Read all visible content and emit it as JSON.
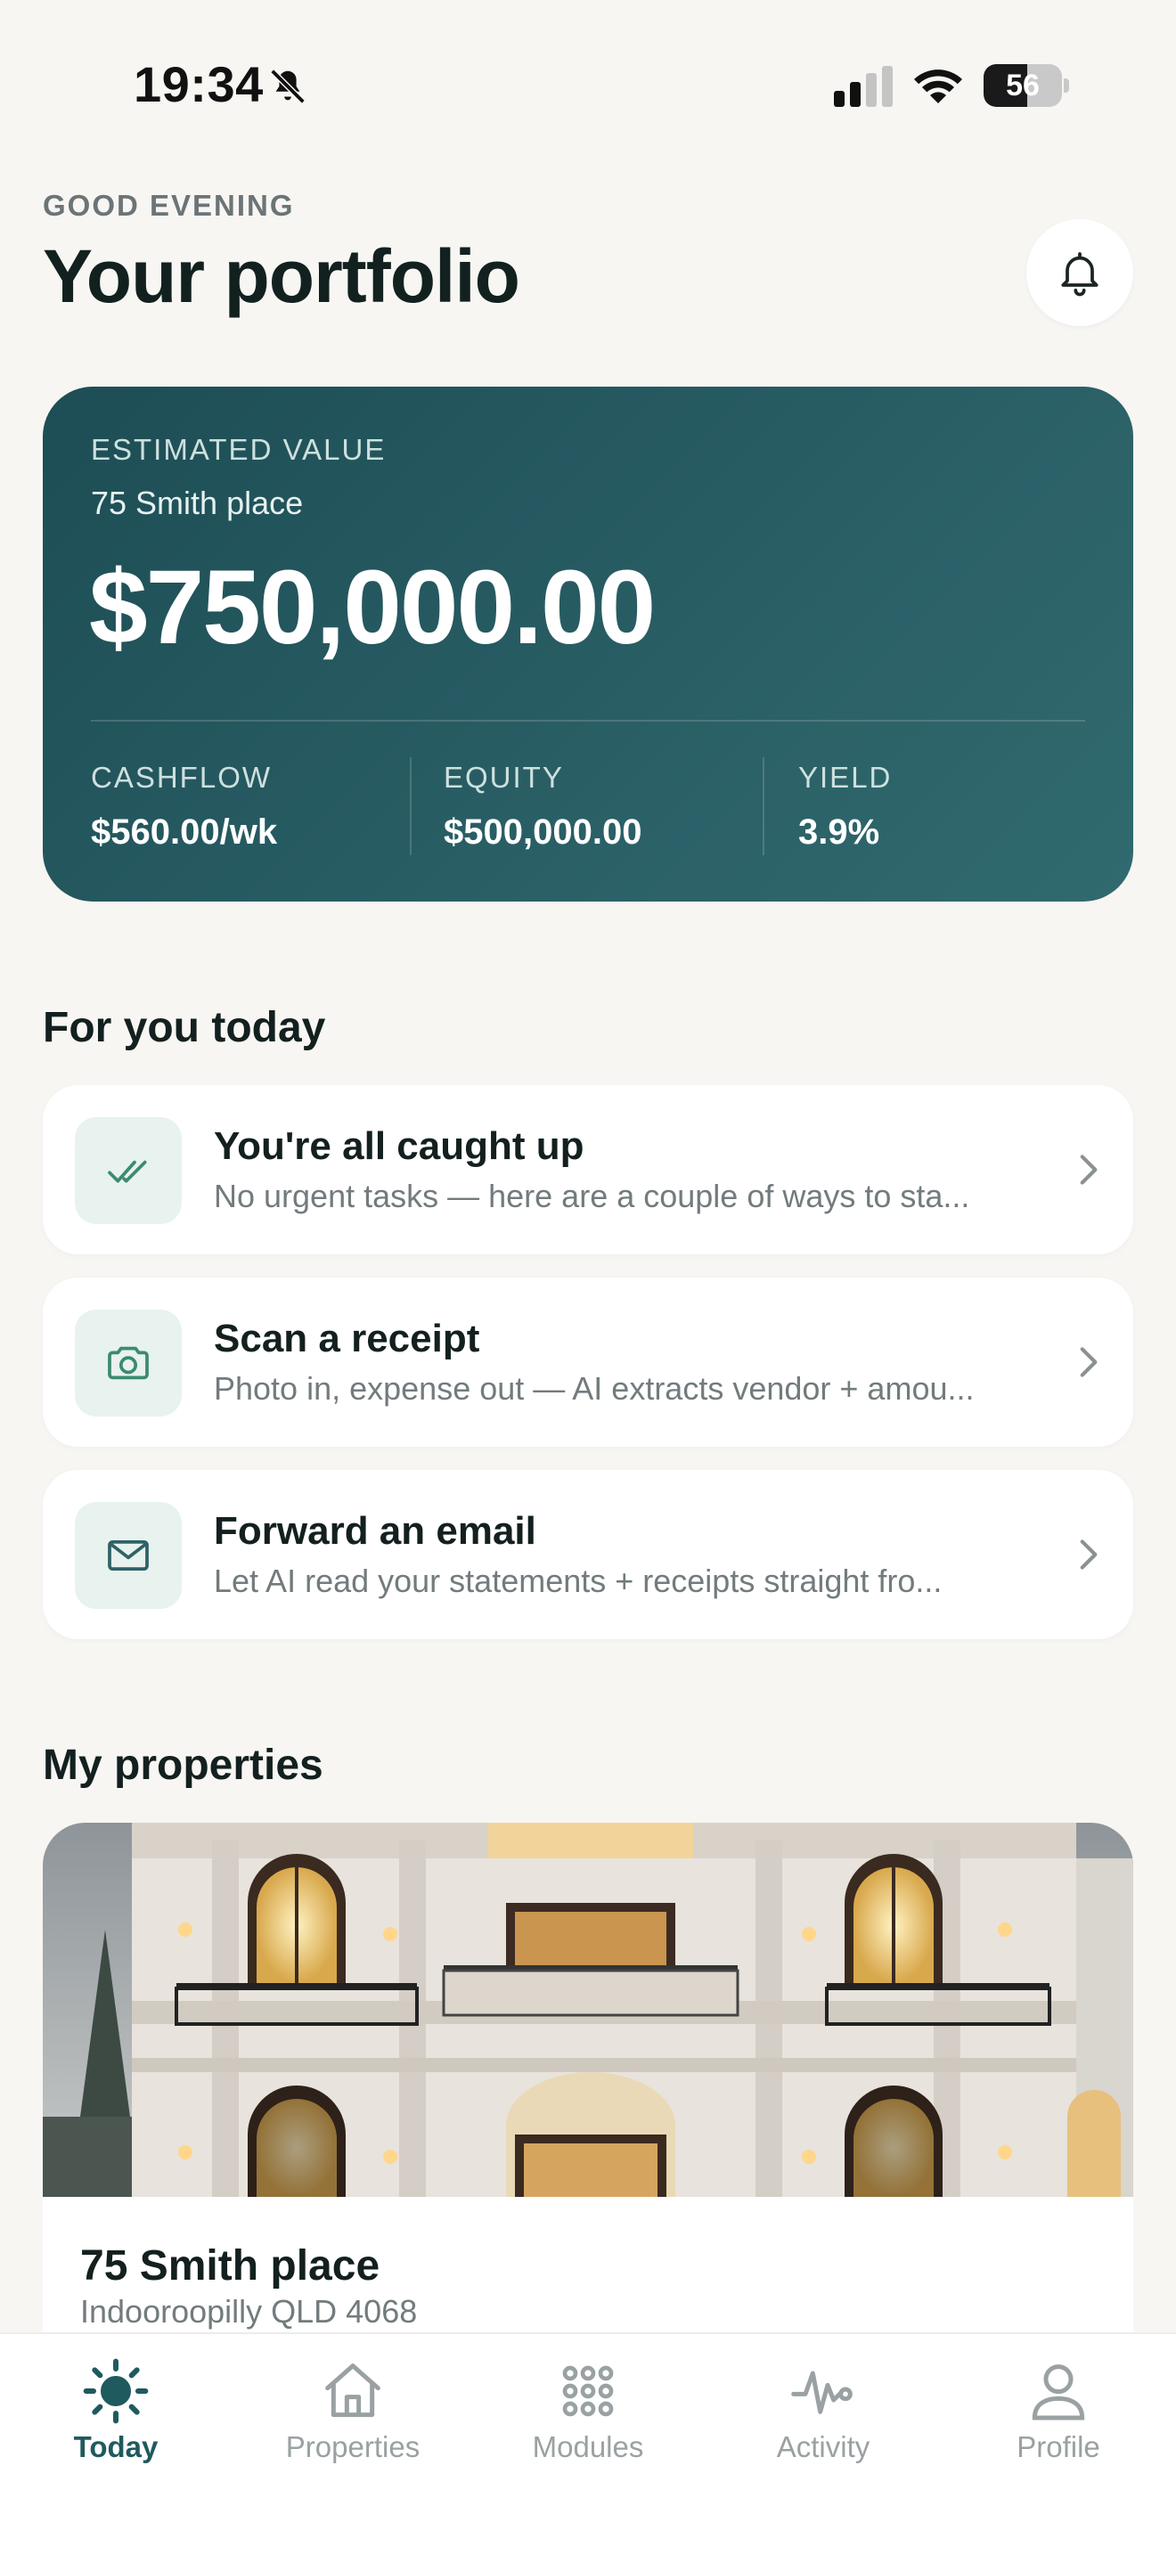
{
  "status_bar": {
    "time": "19:34",
    "battery": "56",
    "battery_level": 0.56
  },
  "header": {
    "greeting": "GOOD EVENING",
    "title": "Your portfolio"
  },
  "value_card": {
    "label": "ESTIMATED VALUE",
    "property": "75 Smith place",
    "amount": "$750,000.00",
    "stats": [
      {
        "label": "CASHFLOW",
        "value": "$560.00/wk"
      },
      {
        "label": "EQUITY",
        "value": "$500,000.00"
      },
      {
        "label": "YIELD",
        "value": "3.9%"
      }
    ]
  },
  "for_you": {
    "title": "For you today",
    "items": [
      {
        "icon": "double-check-icon",
        "title": "You're all caught up",
        "subtitle": "No urgent tasks — here are a couple of ways to sta..."
      },
      {
        "icon": "camera-icon",
        "title": "Scan a receipt",
        "subtitle": "Photo in, expense out — AI extracts vendor + amou..."
      },
      {
        "icon": "mail-icon",
        "title": "Forward an email",
        "subtitle": "Let AI read your statements + receipts straight fro..."
      }
    ]
  },
  "properties": {
    "title": "My properties",
    "items": [
      {
        "name": "75 Smith place",
        "address": "Indooroopilly QLD 4068"
      }
    ]
  },
  "tabs": [
    {
      "label": "Today",
      "icon": "sun-icon",
      "active": true
    },
    {
      "label": "Properties",
      "icon": "house-icon",
      "active": false
    },
    {
      "label": "Modules",
      "icon": "grid-dots-icon",
      "active": false
    },
    {
      "label": "Activity",
      "icon": "pulse-icon",
      "active": false
    },
    {
      "label": "Profile",
      "icon": "person-icon",
      "active": false
    }
  ],
  "colors": {
    "accent": "#1f5a5e",
    "card_start": "#1d4d55",
    "card_end": "#306a6e",
    "icon_bg": "#e8f2ef"
  }
}
